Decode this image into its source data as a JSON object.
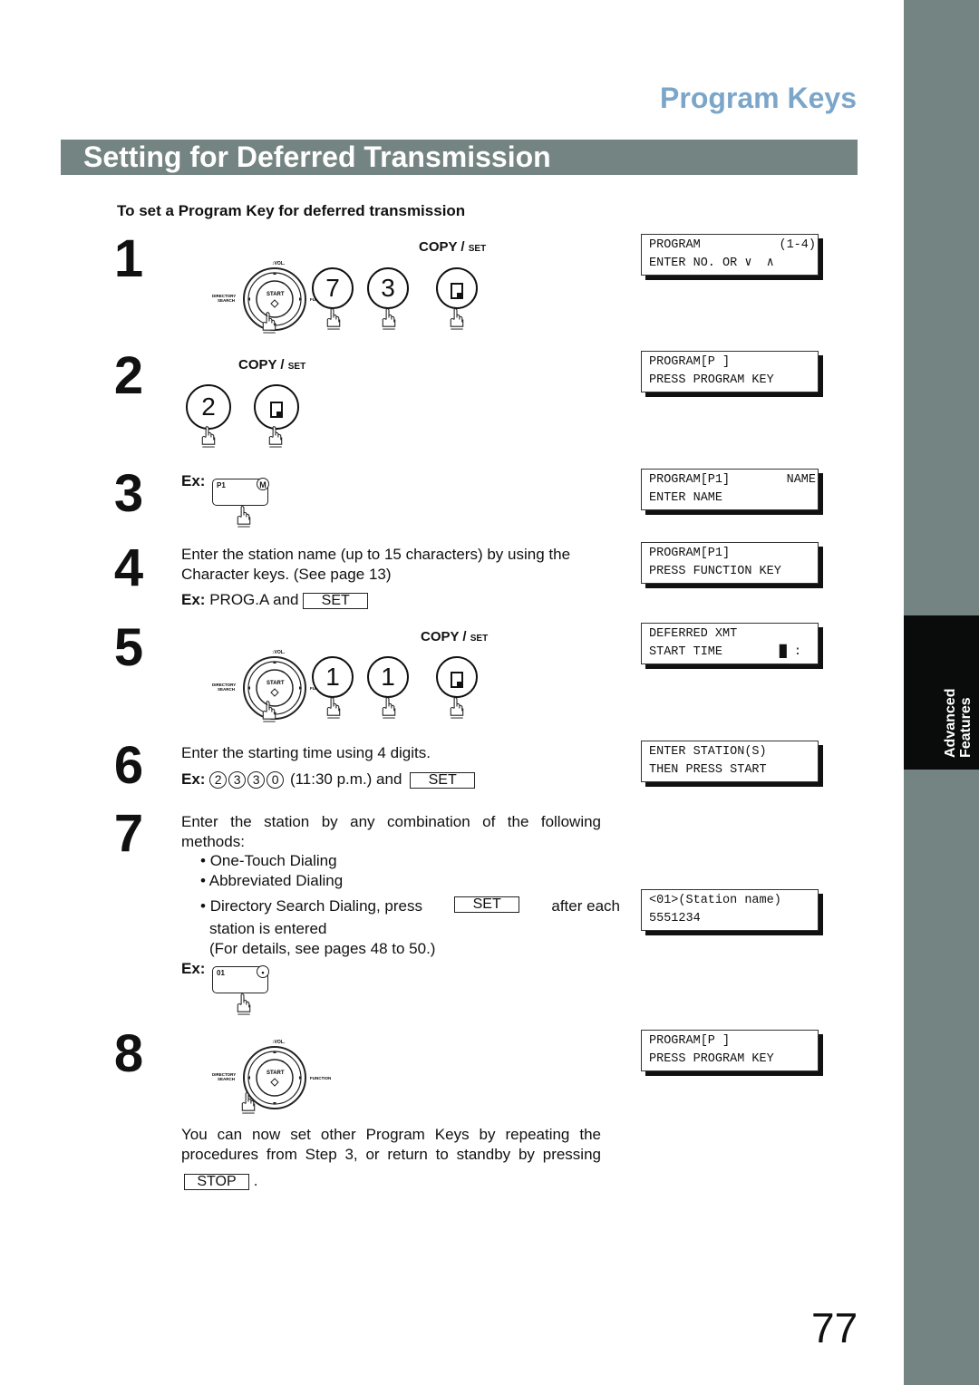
{
  "header": {
    "section_title": "Program Keys",
    "page_title": "Setting for Deferred Transmission",
    "subtitle": "To set a Program Key for deferred transmission"
  },
  "side_tab": {
    "line1": "Advanced",
    "line2": "Features"
  },
  "panel_labels": {
    "copy": "COPY /",
    "set": "SET",
    "vol": "VOL.",
    "directory": "DIRECTORY",
    "search": "SEARCH",
    "start": "START",
    "function": "FUNCTION",
    "ex": "Ex:"
  },
  "steps": [
    {
      "num": "1",
      "keys": [
        "7",
        "3"
      ],
      "lcd": [
        "PROGRAM",
        "(1-4)",
        "ENTER NO. OR ∨  ∧"
      ]
    },
    {
      "num": "2",
      "keys": [
        "2"
      ],
      "lcd": [
        "PROGRAM[P ]",
        "",
        "PRESS PROGRAM KEY"
      ]
    },
    {
      "num": "3",
      "example_key": "P1",
      "example_key_badge": "M",
      "lcd": [
        "PROGRAM[P1]",
        "NAME",
        "ENTER NAME"
      ]
    },
    {
      "num": "4",
      "text": "Enter the station name (up to 15 characters) by using the Character keys.  (See page 13)",
      "example": "PROG.A and",
      "button": "SET",
      "lcd": [
        "PROGRAM[P1]",
        "",
        "PRESS FUNCTION KEY"
      ]
    },
    {
      "num": "5",
      "keys": [
        "1",
        "1"
      ],
      "lcd": [
        "DEFERRED XMT",
        "",
        "START TIME"
      ],
      "lcd_cursor": "█ :"
    },
    {
      "num": "6",
      "text": "Enter the starting time using 4 digits.",
      "example_digits": [
        "2",
        "3",
        "3",
        "0"
      ],
      "example_note": "(11:30 p.m.) and",
      "button": "SET",
      "lcd": [
        "ENTER STATION(S)",
        "",
        "THEN PRESS START"
      ]
    },
    {
      "num": "7",
      "text_line1": "Enter the station by any combination of the following",
      "text_line2": "methods:",
      "bullets": [
        "One-Touch Dialing",
        "Abbreviated Dialing",
        "Directory Search Dialing, press"
      ],
      "bullet3_after": "after each",
      "bullet3_cont": "station is entered",
      "details": "(For details, see pages 48 to 50.)",
      "button": "SET",
      "example_key": "01",
      "lcd": [
        "<01>(Station name)",
        "",
        "5551234"
      ]
    },
    {
      "num": "8",
      "text_line1": "You can now set other Program Keys by repeating the",
      "text_line2": "procedures from Step 3, or return to standby by pressing",
      "button": "STOP",
      "lcd": [
        "PROGRAM[P ]",
        "",
        "PRESS PROGRAM KEY"
      ]
    }
  ],
  "footer": {
    "page_number": "77"
  },
  "colors": {
    "accent_blue": "#7ba6c9",
    "bar_gray": "#748482",
    "tab_black": "#0a0c0b"
  }
}
